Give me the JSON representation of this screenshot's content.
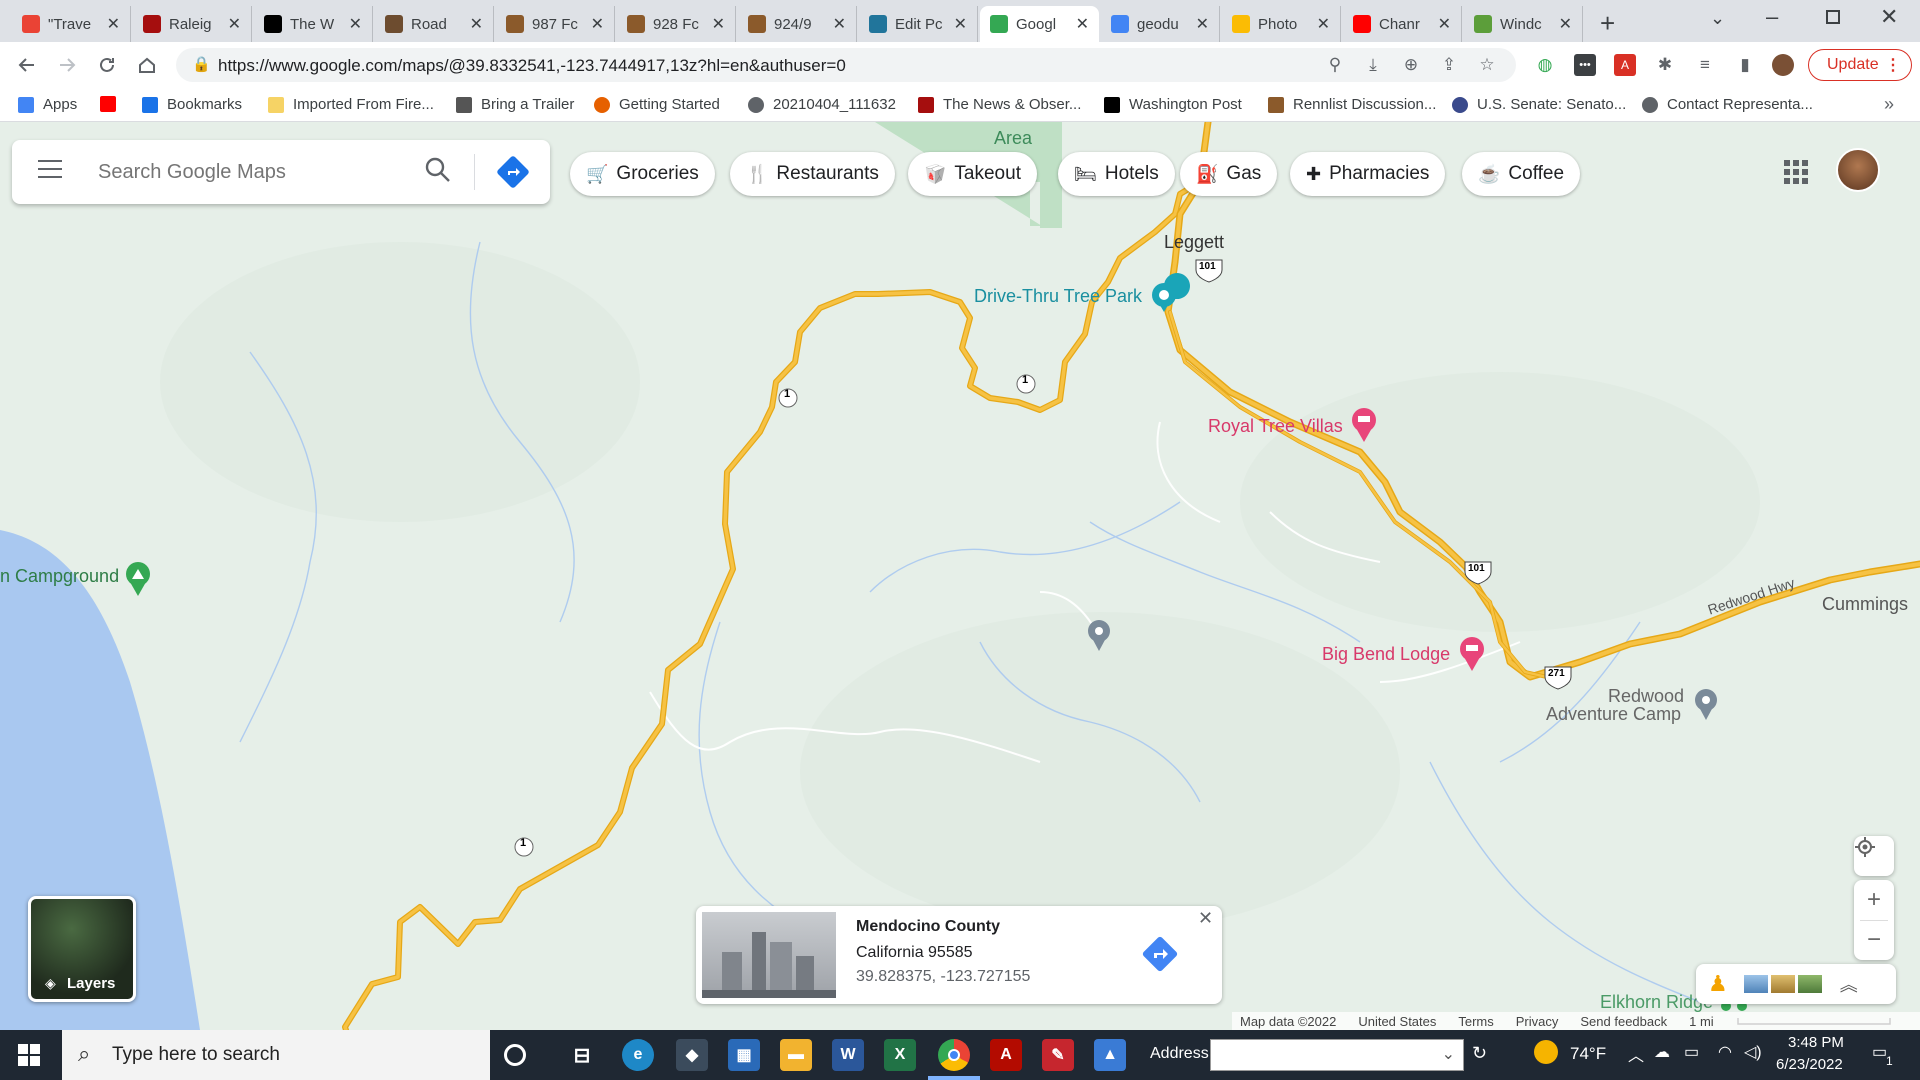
{
  "tabs": [
    {
      "label": "\"Trave",
      "icon": "gmail-icon",
      "color": "#ea4335"
    },
    {
      "label": "Raleig",
      "icon": "news-observer-icon",
      "color": "#a50e0e"
    },
    {
      "label": "The W",
      "icon": "washington-post-icon",
      "color": "#000000"
    },
    {
      "label": "Road",
      "icon": "forum-icon",
      "color": "#6d4c2f"
    },
    {
      "label": "987 Fc",
      "icon": "porsche-crest-icon",
      "color": "#8b5a2b"
    },
    {
      "label": "928 Fc",
      "icon": "porsche-crest-icon",
      "color": "#8b5a2b"
    },
    {
      "label": "924/9",
      "icon": "porsche-crest-icon",
      "color": "#8b5a2b"
    },
    {
      "label": "Edit Pc",
      "icon": "wordpress-icon",
      "color": "#21759b"
    },
    {
      "label": "Googl",
      "icon": "maps-pin-icon",
      "color": "#34a853",
      "active": true
    },
    {
      "label": "geodu",
      "icon": "google-icon",
      "color": "#4285f4"
    },
    {
      "label": "Photo",
      "icon": "photos-icon",
      "color": "#fbbc04"
    },
    {
      "label": "Chanr",
      "icon": "youtube-icon",
      "color": "#ff0000"
    },
    {
      "label": "Windc",
      "icon": "windows-icon",
      "color": "#5c9e3a"
    }
  ],
  "toolbar": {
    "url": "https://www.google.com/maps/@39.8332541,-123.7444917,13z?hl=en&authuser=0",
    "update_label": "Update"
  },
  "bookmarks": [
    {
      "label": "Apps",
      "icon": "apps-grid-icon",
      "color": "#4285f4"
    },
    {
      "label": "",
      "icon": "youtube-icon",
      "color": "#ff0000"
    },
    {
      "label": "Bookmarks",
      "icon": "star-icon",
      "color": "#1a73e8"
    },
    {
      "label": "Imported From Fire...",
      "icon": "folder-icon",
      "color": "#f6d365"
    },
    {
      "label": "Bring a Trailer",
      "icon": "trailer-icon",
      "color": "#555555"
    },
    {
      "label": "Getting Started",
      "icon": "firefox-icon",
      "color": "#e66000"
    },
    {
      "label": "20210404_111632",
      "icon": "globe-icon",
      "color": "#5f6368"
    },
    {
      "label": "The News & Obser...",
      "icon": "news-observer-icon",
      "color": "#a50e0e"
    },
    {
      "label": "Washington Post",
      "icon": "washington-post-icon",
      "color": "#000000"
    },
    {
      "label": "Rennlist Discussion...",
      "icon": "porsche-crest-icon",
      "color": "#8b5a2b"
    },
    {
      "label": "U.S. Senate: Senato...",
      "icon": "senate-seal-icon",
      "color": "#3a4a8c"
    },
    {
      "label": "Contact Representa...",
      "icon": "globe-icon",
      "color": "#5f6368"
    }
  ],
  "maps": {
    "search_placeholder": "Search Google Maps",
    "chips": [
      {
        "label": "Groceries",
        "icon": "cart-icon"
      },
      {
        "label": "Restaurants",
        "icon": "fork-knife-icon"
      },
      {
        "label": "Takeout",
        "icon": "takeout-icon"
      },
      {
        "label": "Hotels",
        "icon": "bed-icon"
      },
      {
        "label": "Gas",
        "icon": "gas-pump-icon"
      },
      {
        "label": "Pharmacies",
        "icon": "pharmacy-icon"
      },
      {
        "label": "Coffee",
        "icon": "coffee-icon"
      }
    ],
    "labels": {
      "area": "Area",
      "leggett": "Leggett",
      "drive_thru": "Drive-Thru Tree Park",
      "royal_tree": "Royal Tree Villas",
      "big_bend": "Big Bend Lodge",
      "campground": "n Campground",
      "redwood_hwy": "Redwood Hwy",
      "cummings": "Cummings",
      "redwood_camp_1": "Redwood",
      "redwood_camp_2": "Adventure Camp",
      "elkhorn": "Elkhorn Ridge"
    },
    "shields": {
      "r1": "1",
      "us101": "101",
      "r271": "271"
    },
    "layers_label": "Layers",
    "infocard": {
      "title": "Mendocino County",
      "line1": "California 95585",
      "coords": "39.828375, -123.727155"
    },
    "attribution": {
      "map_data": "Map data ©2022",
      "country": "United States",
      "terms": "Terms",
      "privacy": "Privacy",
      "feedback": "Send feedback",
      "scale": "1 mi"
    },
    "colors": {
      "road": "#f6c244",
      "road_outline": "#e6a817",
      "water": "#a9c8f0",
      "land": "#e6efe8",
      "park": "#bfe0c5",
      "lodging_pin": "#e8457a",
      "attraction_pin": "#1aa5b8"
    }
  },
  "taskbar": {
    "search_placeholder": "Type here to search",
    "address_label": "Address",
    "weather": "74°F",
    "time": "3:48 PM",
    "date": "6/23/2022",
    "notification_count": "1"
  }
}
